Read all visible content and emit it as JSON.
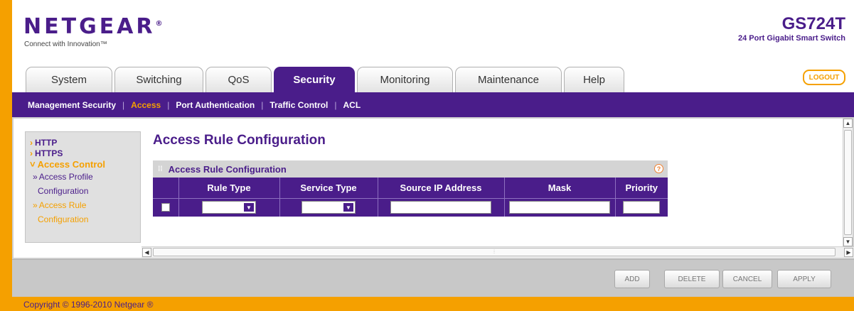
{
  "header": {
    "brand": "NETGEAR",
    "brand_mark": "®",
    "tagline": "Connect with Innovation™",
    "model": "GS724T",
    "model_desc": "24 Port Gigabit Smart Switch",
    "logout_label": "LOGOUT"
  },
  "tabs": [
    {
      "label": "System",
      "active": false
    },
    {
      "label": "Switching",
      "active": false
    },
    {
      "label": "QoS",
      "active": false
    },
    {
      "label": "Security",
      "active": true
    },
    {
      "label": "Monitoring",
      "active": false
    },
    {
      "label": "Maintenance",
      "active": false
    },
    {
      "label": "Help",
      "active": false
    }
  ],
  "subnav": [
    {
      "label": "Management Security",
      "active": false
    },
    {
      "label": "Access",
      "active": true
    },
    {
      "label": "Port Authentication",
      "active": false
    },
    {
      "label": "Traffic Control",
      "active": false
    },
    {
      "label": "ACL",
      "active": false
    }
  ],
  "sidebar": {
    "items": [
      {
        "label": "HTTP"
      },
      {
        "label": "HTTPS"
      },
      {
        "label": "Access Control"
      }
    ],
    "subitems": [
      {
        "line1": "Access Profile",
        "line2": "Configuration"
      },
      {
        "line1": "Access Rule",
        "line2": "Configuration"
      }
    ]
  },
  "page_title": "Access Rule Configuration",
  "panel": {
    "title": "Access Rule Configuration",
    "help": "?",
    "columns": [
      "",
      "Rule Type",
      "Service Type",
      "Source IP Address",
      "Mask",
      "Priority"
    ],
    "row": {
      "checked": false,
      "rule_type": "",
      "service_type": "",
      "source_ip": "",
      "mask": "",
      "priority": ""
    }
  },
  "actions": {
    "add": "ADD",
    "delete": "DELETE",
    "cancel": "CANCEL",
    "apply": "APPLY"
  },
  "copyright": "Copyright © 1996-2010 Netgear ®",
  "colors": {
    "brand_purple": "#4a1d8a",
    "accent_orange": "#f5a000"
  }
}
